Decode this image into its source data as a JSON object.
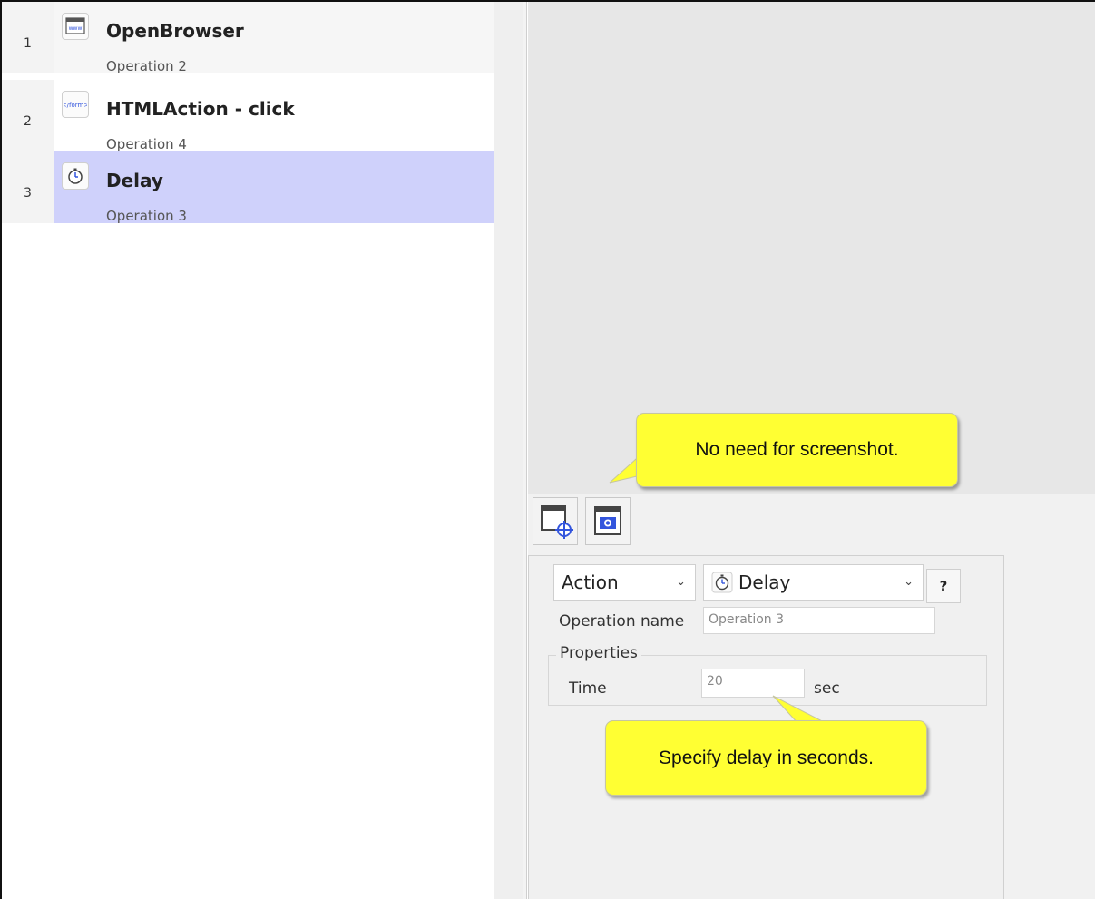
{
  "operations": [
    {
      "number": "1",
      "title": "OpenBrowser",
      "subtitle": "Operation 2",
      "icon": "browser-www-icon",
      "icon_text": "www"
    },
    {
      "number": "2",
      "title": "HTMLAction - click",
      "subtitle": "Operation 4",
      "icon": "form-tag-icon",
      "icon_text": "</form>"
    },
    {
      "number": "3",
      "title": "Delay",
      "subtitle": "Operation 3",
      "icon": "stopwatch-icon",
      "icon_text": ""
    }
  ],
  "selected_index": 2,
  "toolbar": {
    "buttons": [
      {
        "name": "capture-target-button",
        "icon": "window-target-icon"
      },
      {
        "name": "screenshot-button",
        "icon": "window-camera-icon"
      }
    ]
  },
  "properties_panel": {
    "category_select": "Action",
    "action_select": "Delay",
    "help_label": "?",
    "operation_name_label": "Operation name",
    "operation_name_value": "Operation 3",
    "properties_legend": "Properties",
    "time_label": "Time",
    "time_value": "20",
    "time_unit": "sec"
  },
  "callouts": {
    "screenshot": "No need for screenshot.",
    "delay": "Specify delay in seconds."
  },
  "colors": {
    "selected_row": "#cfd1fb",
    "callout_fill": "#ffff33",
    "preview_bg": "#e7e7e7"
  }
}
